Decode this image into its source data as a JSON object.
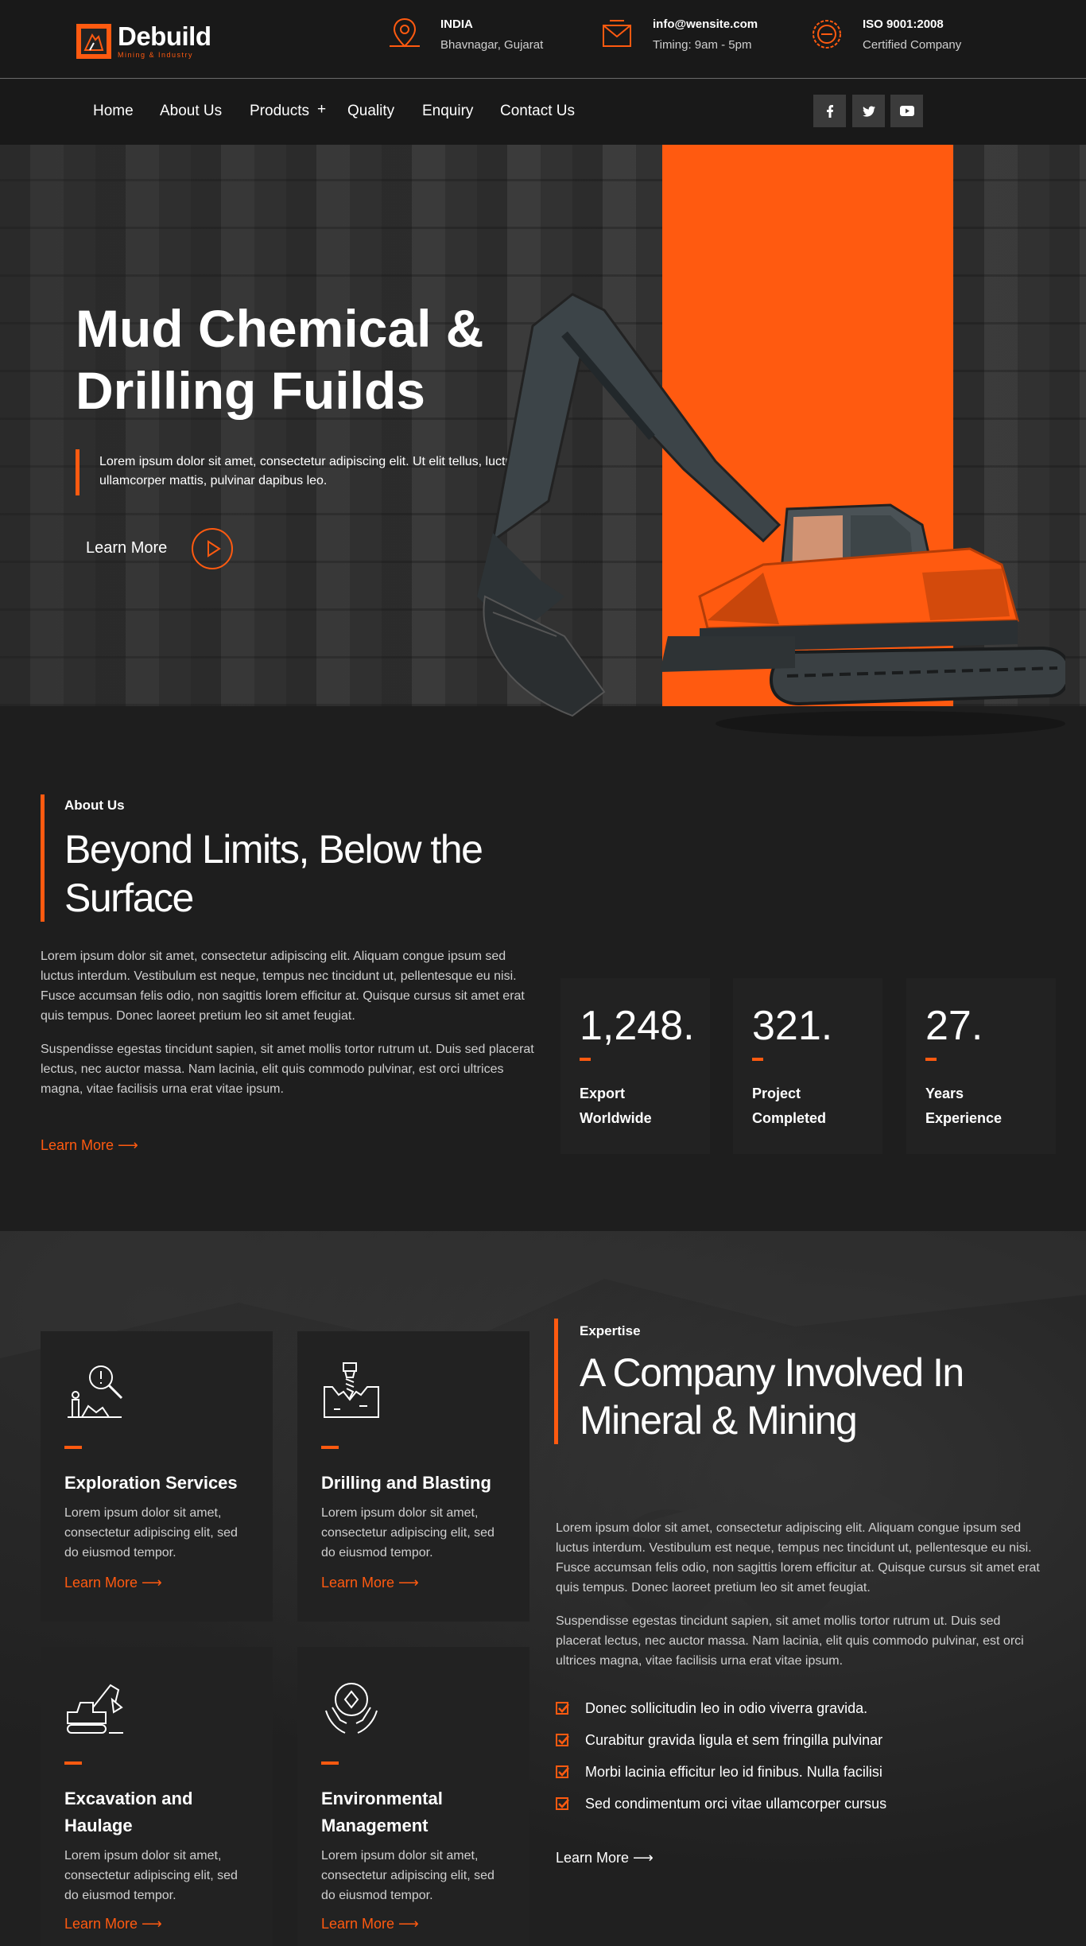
{
  "logo": {
    "name": "Debuild",
    "tagline": "Mining & Industry"
  },
  "contact": [
    {
      "icon": "map-pin-icon",
      "title": "INDIA",
      "detail": "Bhavnagar, Gujarat"
    },
    {
      "icon": "mail-icon",
      "title": "info@wensite.com",
      "detail": "Timing: 9am - 5pm"
    },
    {
      "icon": "iso-badge-icon",
      "title": "ISO 9001:2008",
      "detail": "Certified Company"
    }
  ],
  "nav": {
    "items": [
      "Home",
      "About Us",
      "Products",
      "Quality",
      "Enquiry",
      "Contact Us"
    ],
    "products_toggle": "+",
    "social": [
      "facebook-icon",
      "twitter-icon",
      "youtube-icon"
    ]
  },
  "hero": {
    "title": "Mud Chemical & Drilling Fuilds",
    "description": "Lorem ipsum dolor sit amet, consectetur adipiscing elit. Ut elit tellus, luctus nec ullamcorper mattis, pulvinar dapibus leo.",
    "cta": "Learn More"
  },
  "about": {
    "eyebrow": "About Us",
    "title": "Beyond Limits, Below the Surface",
    "p1": "Lorem ipsum dolor sit amet, consectetur adipiscing elit. Aliquam congue ipsum sed luctus interdum. Vestibulum est neque, tempus nec tincidunt ut, pellentesque eu nisi. Fusce accumsan felis odio, non sagittis lorem efficitur at. Quisque cursus sit amet erat quis tempus. Donec laoreet pretium leo sit amet feugiat.",
    "p2": "Suspendisse egestas tincidunt sapien, sit amet mollis tortor rutrum ut. Duis sed placerat lectus, nec auctor massa. Nam lacinia, elit quis commodo pulvinar, est orci ultrices magna, vitae facilisis urna erat vitae ipsum.",
    "link": "Learn More ⟶",
    "stats": [
      {
        "number": "1,248.",
        "label": "Export Worldwide"
      },
      {
        "number": "321.",
        "label": "Project Completed"
      },
      {
        "number": "27.",
        "label": "Years Experience"
      }
    ]
  },
  "services": [
    {
      "icon": "exploration-icon",
      "title": "Exploration Services",
      "text": "Lorem ipsum dolor sit amet, consectetur adipiscing elit, sed do eiusmod tempor.",
      "link": "Learn More ⟶"
    },
    {
      "icon": "drilling-icon",
      "title": "Drilling and Blasting",
      "text": "Lorem ipsum dolor sit amet, consectetur adipiscing elit, sed do eiusmod tempor.",
      "link": "Learn More ⟶"
    },
    {
      "icon": "excavator-icon",
      "title": "Excavation and Haulage",
      "text": "Lorem ipsum dolor sit amet, consectetur adipiscing elit, sed do eiusmod tempor.",
      "link": "Learn More ⟶"
    },
    {
      "icon": "environment-icon",
      "title": "Environmental Management",
      "text": "Lorem ipsum dolor sit amet, consectetur adipiscing elit, sed do eiusmod tempor.",
      "link": "Learn More ⟶"
    }
  ],
  "expertise": {
    "eyebrow": "Expertise",
    "title": "A Company Involved In Mineral & Mining",
    "p1": "Lorem ipsum dolor sit amet, consectetur adipiscing elit. Aliquam congue ipsum sed luctus interdum. Vestibulum est neque, tempus nec tincidunt ut, pellentesque eu nisi. Fusce accumsan felis odio, non sagittis lorem efficitur at. Quisque cursus sit amet erat quis tempus. Donec laoreet pretium leo sit amet feugiat.",
    "p2": "Suspendisse egestas tincidunt sapien, sit amet mollis tortor rutrum ut. Duis sed placerat lectus, nec auctor massa. Nam lacinia, elit quis commodo pulvinar, est orci ultrices magna, vitae facilisis urna erat vitae ipsum.",
    "checklist": [
      "Donec sollicitudin leo in odio viverra gravida.",
      "Curabitur gravida ligula et sem fringilla pulvinar",
      "Morbi lacinia efficitur leo id finibus. Nulla facilisi",
      "Sed condimentum orci vitae ullamcorper cursus"
    ],
    "link": "Learn More ⟶"
  },
  "colors": {
    "accent": "#ff5a10",
    "background": "#1e1e1e",
    "card": "#222222"
  }
}
